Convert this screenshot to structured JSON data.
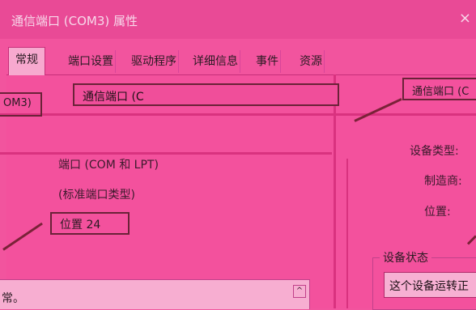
{
  "window": {
    "title": "通信端口 (COM3) 属性",
    "close_glyph": "×"
  },
  "tabs": [
    {
      "label": "常规",
      "active": true
    },
    {
      "label": "端口设置"
    },
    {
      "label": "驱动程序"
    },
    {
      "label": "详细信息"
    },
    {
      "label": "事件"
    },
    {
      "label": "资源"
    }
  ],
  "left_panel": {
    "device_name": "通信端口 (C",
    "com_fragment": "OM3)",
    "device_type": "端口 (COM 和 LPT)",
    "manufacturer": "(标准端口类型)",
    "location": "位置 24",
    "bottom_text": "常。",
    "scroll_glyph": "^"
  },
  "right_panel": {
    "device_name": "通信端口 (C",
    "device_type_label": "设备类型:",
    "manufacturer_label": "制造商:",
    "location_label": "位置:",
    "status_group_label": "设备状态",
    "status_text": "这个设备运转正"
  }
}
